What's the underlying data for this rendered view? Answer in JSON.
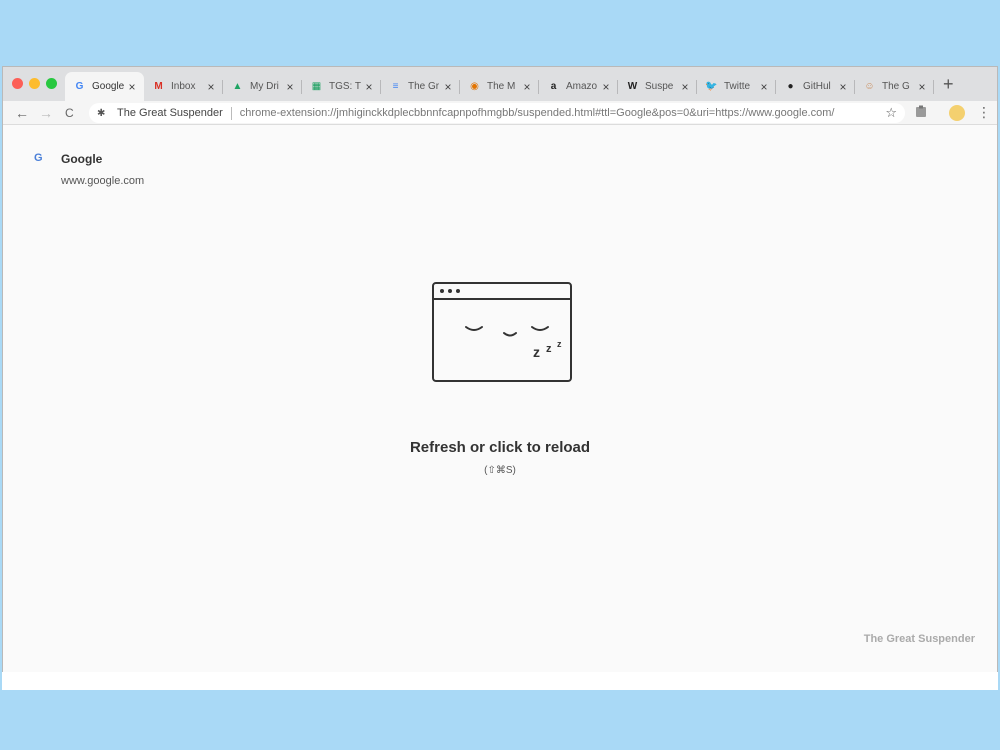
{
  "tabs": [
    {
      "title": "Google",
      "favicon": "G",
      "color": "#4285f4",
      "icon": "google-icon",
      "active": true
    },
    {
      "title": "Inbox",
      "favicon": "M",
      "color": "#d93025",
      "icon": "gmail-icon"
    },
    {
      "title": "My Dri",
      "favicon": "▲",
      "color": "#1fa463",
      "icon": "drive-icon"
    },
    {
      "title": "TGS: T",
      "favicon": "▦",
      "color": "#0f9d58",
      "icon": "sheets-icon"
    },
    {
      "title": "The Gr",
      "favicon": "≡",
      "color": "#4285f4",
      "icon": "docs-icon"
    },
    {
      "title": "The M",
      "favicon": "◉",
      "color": "#e37400",
      "icon": "chrome-icon"
    },
    {
      "title": "Amazo",
      "favicon": "a",
      "color": "#222222",
      "icon": "amazon-icon"
    },
    {
      "title": "Suspe",
      "favicon": "W",
      "color": "#222222",
      "icon": "wikipedia-icon"
    },
    {
      "title": "Twitte",
      "favicon": "🐦",
      "color": "#1da1f2",
      "icon": "twitter-icon"
    },
    {
      "title": "GitHul",
      "favicon": "●",
      "color": "#222222",
      "icon": "github-icon"
    },
    {
      "title": "The G",
      "favicon": "☺",
      "color": "#c98b5a",
      "icon": "suspender-icon"
    }
  ],
  "tab_close": "×",
  "new_tab": "+",
  "toolbar": {
    "back": "←",
    "forward": "→",
    "reload": "C",
    "extension_icon": "✱",
    "extension_name": "The Great Suspender",
    "url": "chrome-extension://jmhiginckkdplecbbnnfcapnpofhmgbb/suspended.html#ttl=Google&pos=0&uri=https://www.google.com/",
    "star": "☆",
    "menu": "⋮"
  },
  "page": {
    "favicon": "G",
    "title": "Google",
    "url": "www.google.com",
    "zzz": [
      "z",
      "z",
      "z"
    ],
    "reload_text": "Refresh or click to reload",
    "shortcut": "(⇧⌘S)",
    "brand": "The Great Suspender"
  },
  "colors": {
    "background": "#a9d9f6",
    "tabstrip": "#dedfe1",
    "page": "#fafafa"
  }
}
